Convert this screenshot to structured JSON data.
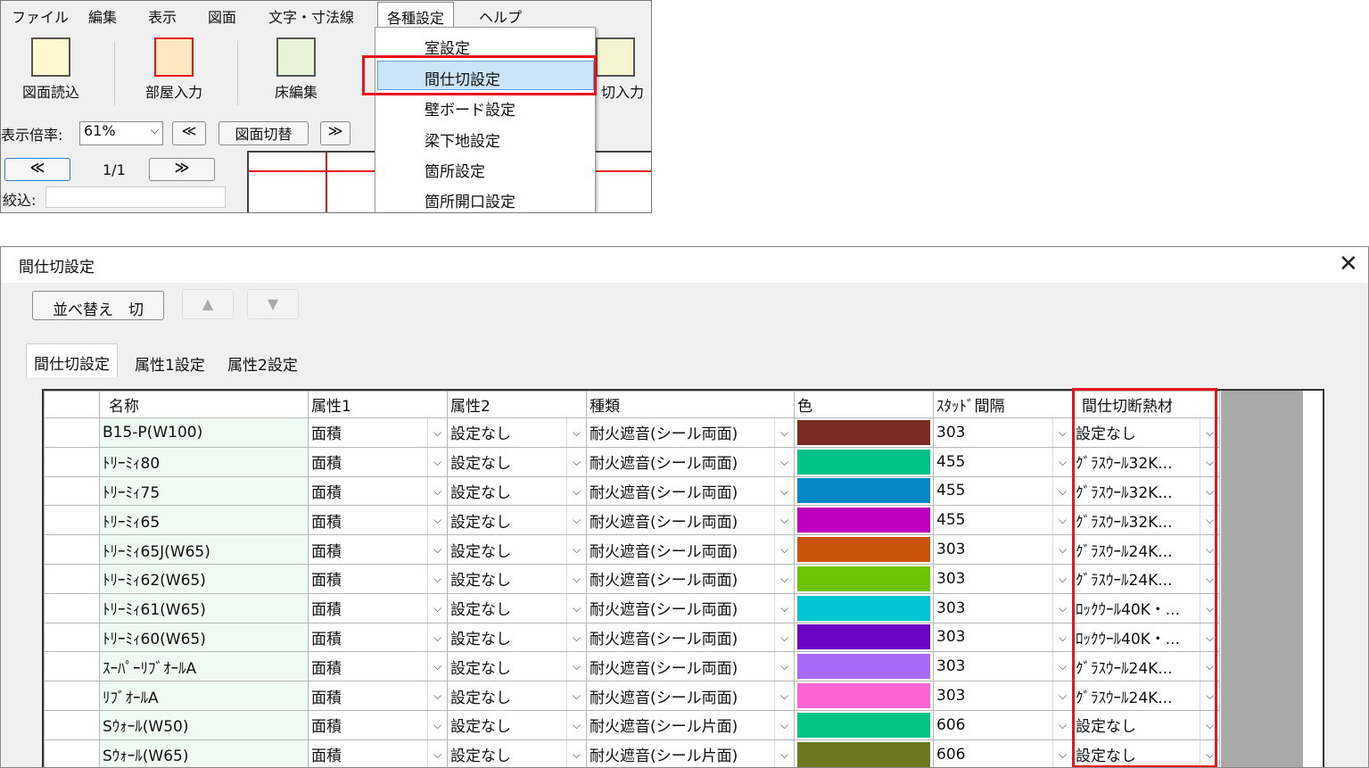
{
  "menu": {
    "items": [
      "ファイル",
      "編集",
      "表示",
      "図面",
      "文字・寸法線",
      "各種設定",
      "ヘルプ"
    ]
  },
  "toolbar": {
    "buttons": [
      "図面読込",
      "部屋入力",
      "床編集",
      "切入力"
    ]
  },
  "zoom": {
    "label": "表示倍率:",
    "value": "61%",
    "prev": "≪",
    "switch": "図面切替",
    "next": "≫"
  },
  "nav": {
    "prev": "≪",
    "page": "1/1",
    "next": "≫",
    "filter_label": "絞込:"
  },
  "dropdown": {
    "items": [
      "室設定",
      "間仕切設定",
      "壁ボード設定",
      "梁下地設定",
      "箇所設定",
      "箇所開口設定"
    ]
  },
  "dialog": {
    "title": "間仕切設定",
    "close": "✕",
    "sort_button": "並べ替え　切",
    "up": "▲",
    "down": "▼",
    "tabs": [
      "間仕切設定",
      "属性1設定",
      "属性2設定"
    ]
  },
  "grid": {
    "headers": [
      "名称",
      "属性1",
      "属性2",
      "種類",
      "色",
      "ｽﾀｯﾄﾞ間隔",
      "間仕切断熱材"
    ],
    "rows": [
      {
        "name": "B15-P(W100)",
        "attr1": "面積",
        "attr2": "設定なし",
        "kind": "耐火遮音(シール両面)",
        "color": "#7b2b22",
        "stud": "303",
        "insul": "設定なし"
      },
      {
        "name": "ﾄﾘｰﾐｨ80",
        "attr1": "面積",
        "attr2": "設定なし",
        "kind": "耐火遮音(シール両面)",
        "color": "#00c388",
        "stud": "455",
        "insul": "ｸﾞﾗｽｳｰﾙ32K..."
      },
      {
        "name": "ﾄﾘｰﾐｨ75",
        "attr1": "面積",
        "attr2": "設定なし",
        "kind": "耐火遮音(シール両面)",
        "color": "#0488c6",
        "stud": "455",
        "insul": "ｸﾞﾗｽｳｰﾙ32K..."
      },
      {
        "name": "ﾄﾘｰﾐｨ65",
        "attr1": "面積",
        "attr2": "設定なし",
        "kind": "耐火遮音(シール両面)",
        "color": "#c000c0",
        "stud": "455",
        "insul": "ｸﾞﾗｽｳｰﾙ32K..."
      },
      {
        "name": "ﾄﾘｰﾐｨ65J(W65)",
        "attr1": "面積",
        "attr2": "設定なし",
        "kind": "耐火遮音(シール両面)",
        "color": "#c85408",
        "stud": "303",
        "insul": "ｸﾞﾗｽｳｰﾙ24K..."
      },
      {
        "name": "ﾄﾘｰﾐｨ62(W65)",
        "attr1": "面積",
        "attr2": "設定なし",
        "kind": "耐火遮音(シール両面)",
        "color": "#6cc404",
        "stud": "303",
        "insul": "ｸﾞﾗｽｳｰﾙ24K..."
      },
      {
        "name": "ﾄﾘｰﾐｨ61(W65)",
        "attr1": "面積",
        "attr2": "設定なし",
        "kind": "耐火遮音(シール両面)",
        "color": "#04c4d4",
        "stud": "303",
        "insul": "ﾛｯｸｳｰﾙ40K・..."
      },
      {
        "name": "ﾄﾘｰﾐｨ60(W65)",
        "attr1": "面積",
        "attr2": "設定なし",
        "kind": "耐火遮音(シール両面)",
        "color": "#6c04c4",
        "stud": "303",
        "insul": "ﾛｯｸｳｰﾙ40K・..."
      },
      {
        "name": "ｽｰﾊﾟｰﾘﾌﾞｵｰﾙA",
        "attr1": "面積",
        "attr2": "設定なし",
        "kind": "耐火遮音(シール両面)",
        "color": "#a868f8",
        "stud": "303",
        "insul": "ｸﾞﾗｽｳｰﾙ24K..."
      },
      {
        "name": "ﾘﾌﾞｵｰﾙA",
        "attr1": "面積",
        "attr2": "設定なし",
        "kind": "耐火遮音(シール両面)",
        "color": "#fc64d4",
        "stud": "303",
        "insul": "ｸﾞﾗｽｳｰﾙ24K..."
      },
      {
        "name": "Sｳｫｰﾙ(W50)",
        "attr1": "面積",
        "attr2": "設定なし",
        "kind": "耐火遮音(シール片面)",
        "color": "#04c484",
        "stud": "606",
        "insul": "設定なし"
      },
      {
        "name": "Sｳｫｰﾙ(W65)",
        "attr1": "面積",
        "attr2": "設定なし",
        "kind": "耐火遮音(シール片面)",
        "color": "#6c7820",
        "stud": "606",
        "insul": "設定なし"
      }
    ]
  }
}
